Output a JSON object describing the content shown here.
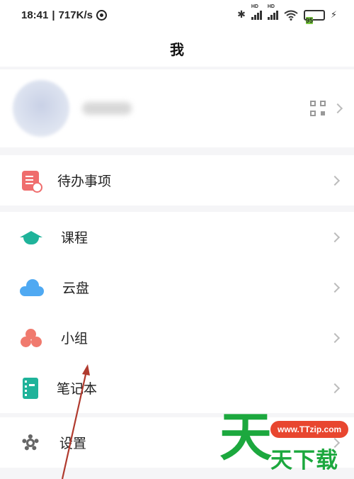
{
  "status_bar": {
    "time": "18:41",
    "speed": "717K/s",
    "signal_label_1": "HD",
    "signal_label_2": "HD",
    "battery": "95"
  },
  "header": {
    "title": "我"
  },
  "menu": {
    "todo": "待办事项",
    "course": "课程",
    "cloud": "云盘",
    "group": "小组",
    "notebook": "笔记本",
    "settings": "设置"
  },
  "watermark": {
    "glyph": "天",
    "url": "www.TTzip.com",
    "text": "天下载"
  },
  "colors": {
    "todo": "#ef6d6d",
    "course": "#1fb39a",
    "cloud": "#4fa9f2",
    "group": "#f07a6e",
    "notebook": "#1fb39a",
    "watermark_green": "#1ca83e",
    "watermark_red": "#e8462f",
    "arrow": "#b03a2e"
  },
  "icons": [
    "bluetooth-icon",
    "signal-icon",
    "wifi-icon",
    "battery-icon",
    "charging-icon",
    "qr-code-icon",
    "chevron-right-icon",
    "todo-icon",
    "course-icon",
    "cloud-icon",
    "group-icon",
    "notebook-icon",
    "settings-icon"
  ]
}
